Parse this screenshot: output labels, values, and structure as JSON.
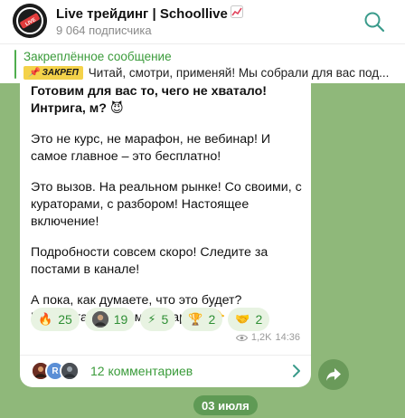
{
  "header": {
    "title": "Live трейдинг | Schoollive",
    "title_icon": "chart-increasing-icon",
    "subscribers": "9 064 подписчика",
    "search_icon": "search-icon"
  },
  "pinned": {
    "title": "Закреплённое сообщение",
    "tag": "ЗАКРЕП",
    "text": "Читай, смотри, применяй!  Мы собрали для вас под..."
  },
  "message": {
    "paragraphs": [
      "Готовим для вас то, чего не хватало! Интрига, м? 😈",
      "Это не курс, не марафон, не вебинар! И самое главное – это бесплатно!",
      "Это вызов. На реальном рынке! Со своими, с кураторами, с разбором! Настоящее включение!",
      "Подробности совсем скоро! Следите за постами в канале!",
      "А пока, как думаете, что это будет? Предлагайте в комментариях 👇"
    ],
    "views": "1,2K",
    "time": "14:36"
  },
  "reactions": [
    {
      "emoji": "🔥",
      "count": "25",
      "icon": "fire-icon"
    },
    {
      "emoji": "",
      "count": "19",
      "icon": "custom-avatar-reaction"
    },
    {
      "emoji": "⚡",
      "count": "5",
      "icon": "lightning-icon"
    },
    {
      "emoji": "🏆",
      "count": "2",
      "icon": "trophy-icon"
    },
    {
      "emoji": "🤝",
      "count": "2",
      "icon": "handshake-icon"
    }
  ],
  "comments": {
    "label": "12 комментариев",
    "avatar_letter": "R"
  },
  "date_badge": "03 июля",
  "colors": {
    "accent": "#3a9b3a",
    "background": "#8fb87a",
    "pin_tag": "#f4d24a"
  }
}
